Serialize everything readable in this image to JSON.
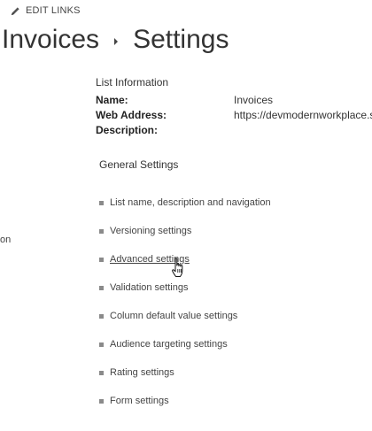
{
  "header": {
    "edit_links_label": "EDIT LINKS",
    "edit_icon": "pencil-icon",
    "breadcrumb": [
      "Invoices",
      "Settings"
    ],
    "breadcrumb_separator_icon": "chevron-right-icon"
  },
  "left_fragment": "on",
  "list_information": {
    "title": "List Information",
    "rows": [
      {
        "key": "Name:",
        "value": "Invoices"
      },
      {
        "key": "Web Address:",
        "value": "https://devmodernworkplace.s"
      },
      {
        "key": "Description:",
        "value": ""
      }
    ]
  },
  "general_settings": {
    "title": "General Settings",
    "items": [
      {
        "label": "List name, description and navigation"
      },
      {
        "label": "Versioning settings"
      },
      {
        "label": "Advanced settings",
        "hovered": true
      },
      {
        "label": "Validation settings"
      },
      {
        "label": "Column default value settings"
      },
      {
        "label": "Audience targeting settings"
      },
      {
        "label": "Rating settings"
      },
      {
        "label": "Form settings"
      }
    ]
  },
  "pointer_icon": "hand-pointer-icon",
  "colors": {
    "text": "#333333",
    "bullet": "#8a8a8a",
    "background": "#ffffff"
  }
}
